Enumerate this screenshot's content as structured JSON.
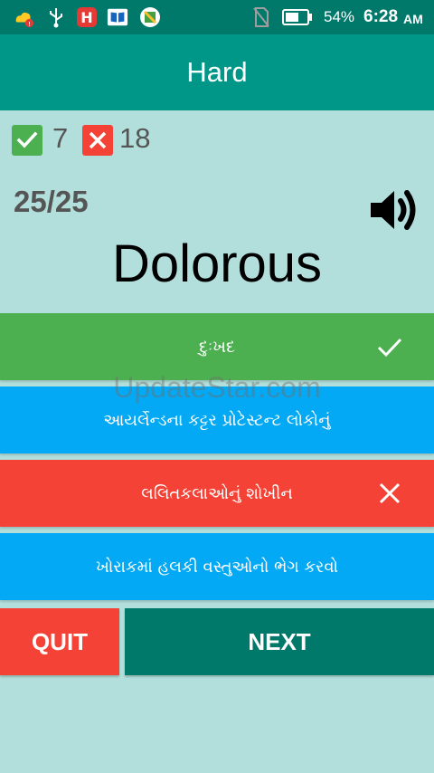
{
  "status_bar": {
    "battery_percent": "54%",
    "time_value": "6:28",
    "time_ampm": "AM",
    "icons": [
      "cloud-warning-icon",
      "usb-icon",
      "app-h-icon",
      "book-icon",
      "map-icon",
      "no-sim-icon",
      "battery-icon"
    ]
  },
  "app_bar": {
    "title": "Hard"
  },
  "score": {
    "correct": "7",
    "wrong": "18"
  },
  "progress": "25/25",
  "question": {
    "word": "Dolorous"
  },
  "options": [
    {
      "text": "દુઃખદ",
      "state": "correct"
    },
    {
      "text": "આયર્લેન્ડના કટ્ટર પ્રોટેસ્ટન્ટ લોકોનું",
      "state": "neutral"
    },
    {
      "text": "લલિતકલાઓનું શોખીન",
      "state": "wrong"
    },
    {
      "text": "ખોરાકમાં હલકી વસ્તુઓનો ભેગ કરવો",
      "state": "neutral"
    }
  ],
  "buttons": {
    "quit": "QUIT",
    "next": "NEXT"
  },
  "watermark": "UpdateStar.com",
  "colors": {
    "status_bar": "#00796b",
    "app_bar": "#009688",
    "background": "#b2dfdb",
    "correct": "#4caf50",
    "wrong": "#f44336",
    "neutral": "#03a9f4",
    "next": "#00796b"
  }
}
